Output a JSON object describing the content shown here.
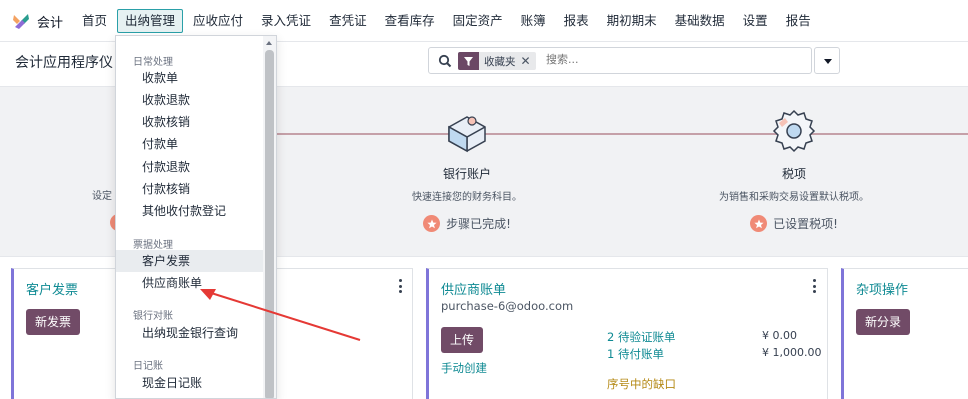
{
  "nav": {
    "app_name": "会计",
    "items": [
      "首页",
      "出纳管理",
      "应收应付",
      "录入凭证",
      "查凭证",
      "查看库存",
      "固定资产",
      "账簿",
      "报表",
      "期初期末",
      "基础数据",
      "设置",
      "报告"
    ],
    "active_index": 1
  },
  "control": {
    "title": "会计应用程序仪",
    "facet_label": "收藏夹",
    "search_placeholder": "搜索..."
  },
  "onboarding": {
    "left_fragment": "设定",
    "steps": [
      {
        "title": "银行账户",
        "desc": "快速连接您的财务科目。",
        "done_text": "步骤已完成!"
      },
      {
        "title": "税项",
        "desc": "为销售和采购交易设置默认税项。",
        "done_text": "已设置税项!"
      }
    ]
  },
  "cards": {
    "customer_invoices": {
      "title": "客户发票",
      "button": "新发票"
    },
    "vendor_bills": {
      "title": "供应商账单",
      "email": "purchase-6@odoo.com",
      "button": "上传",
      "manual_link": "手动创建",
      "to_validate": "2 待验证账单",
      "to_validate_amount": "¥ 0.00",
      "to_pay": "1 待付账单",
      "to_pay_amount": "¥ 1,000.00",
      "gaps": "序号中的缺口"
    },
    "misc": {
      "title": "杂项操作",
      "button": "新分录"
    }
  },
  "dropdown": {
    "sections": [
      {
        "header": "日常处理",
        "items": [
          "收款单",
          "收款退款",
          "收款核销",
          "付款单",
          "付款退款",
          "付款核销",
          "其他收付款登记"
        ]
      },
      {
        "header": "票据处理",
        "items": [
          "客户发票",
          "供应商账单"
        ]
      },
      {
        "header": "银行对账",
        "items": [
          "出纳现金银行查询"
        ]
      },
      {
        "header": "日记账",
        "items": [
          "现金日记账"
        ]
      }
    ]
  },
  "colors": {
    "brand": "#714b67",
    "teal": "#0f8a93",
    "accent_done": "#f08a76",
    "annotation_arrow": "#e53935"
  }
}
